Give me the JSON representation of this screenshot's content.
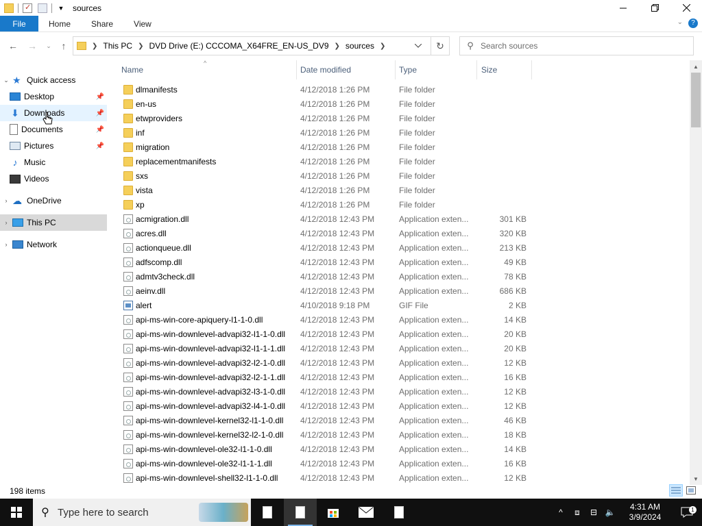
{
  "window": {
    "title": "sources",
    "ribbon_tabs": [
      "File",
      "Home",
      "Share",
      "View"
    ]
  },
  "address": {
    "crumbs": [
      "This PC",
      "DVD Drive (E:) CCCOMA_X64FRE_EN-US_DV9",
      "sources"
    ],
    "search_placeholder": "Search sources"
  },
  "nav": {
    "quick_access": "Quick access",
    "desktop": "Desktop",
    "downloads": "Downloads",
    "documents": "Documents",
    "pictures": "Pictures",
    "music": "Music",
    "videos": "Videos",
    "onedrive": "OneDrive",
    "this_pc": "This PC",
    "network": "Network"
  },
  "columns": {
    "name": "Name",
    "date": "Date modified",
    "type": "Type",
    "size": "Size"
  },
  "files": [
    {
      "name": "dlmanifests",
      "date": "4/12/2018 1:26 PM",
      "type": "File folder",
      "size": "",
      "kind": "folder"
    },
    {
      "name": "en-us",
      "date": "4/12/2018 1:26 PM",
      "type": "File folder",
      "size": "",
      "kind": "folder"
    },
    {
      "name": "etwproviders",
      "date": "4/12/2018 1:26 PM",
      "type": "File folder",
      "size": "",
      "kind": "folder"
    },
    {
      "name": "inf",
      "date": "4/12/2018 1:26 PM",
      "type": "File folder",
      "size": "",
      "kind": "folder"
    },
    {
      "name": "migration",
      "date": "4/12/2018 1:26 PM",
      "type": "File folder",
      "size": "",
      "kind": "folder"
    },
    {
      "name": "replacementmanifests",
      "date": "4/12/2018 1:26 PM",
      "type": "File folder",
      "size": "",
      "kind": "folder"
    },
    {
      "name": "sxs",
      "date": "4/12/2018 1:26 PM",
      "type": "File folder",
      "size": "",
      "kind": "folder"
    },
    {
      "name": "vista",
      "date": "4/12/2018 1:26 PM",
      "type": "File folder",
      "size": "",
      "kind": "folder"
    },
    {
      "name": "xp",
      "date": "4/12/2018 1:26 PM",
      "type": "File folder",
      "size": "",
      "kind": "folder"
    },
    {
      "name": "acmigration.dll",
      "date": "4/12/2018 12:43 PM",
      "type": "Application exten...",
      "size": "301 KB",
      "kind": "file"
    },
    {
      "name": "acres.dll",
      "date": "4/12/2018 12:43 PM",
      "type": "Application exten...",
      "size": "320 KB",
      "kind": "file"
    },
    {
      "name": "actionqueue.dll",
      "date": "4/12/2018 12:43 PM",
      "type": "Application exten...",
      "size": "213 KB",
      "kind": "file"
    },
    {
      "name": "adfscomp.dll",
      "date": "4/12/2018 12:43 PM",
      "type": "Application exten...",
      "size": "49 KB",
      "kind": "file"
    },
    {
      "name": "admtv3check.dll",
      "date": "4/12/2018 12:43 PM",
      "type": "Application exten...",
      "size": "78 KB",
      "kind": "file"
    },
    {
      "name": "aeinv.dll",
      "date": "4/12/2018 12:43 PM",
      "type": "Application exten...",
      "size": "686 KB",
      "kind": "file"
    },
    {
      "name": "alert",
      "date": "4/10/2018 9:18 PM",
      "type": "GIF File",
      "size": "2 KB",
      "kind": "gif"
    },
    {
      "name": "api-ms-win-core-apiquery-l1-1-0.dll",
      "date": "4/12/2018 12:43 PM",
      "type": "Application exten...",
      "size": "14 KB",
      "kind": "file"
    },
    {
      "name": "api-ms-win-downlevel-advapi32-l1-1-0.dll",
      "date": "4/12/2018 12:43 PM",
      "type": "Application exten...",
      "size": "20 KB",
      "kind": "file"
    },
    {
      "name": "api-ms-win-downlevel-advapi32-l1-1-1.dll",
      "date": "4/12/2018 12:43 PM",
      "type": "Application exten...",
      "size": "20 KB",
      "kind": "file"
    },
    {
      "name": "api-ms-win-downlevel-advapi32-l2-1-0.dll",
      "date": "4/12/2018 12:43 PM",
      "type": "Application exten...",
      "size": "12 KB",
      "kind": "file"
    },
    {
      "name": "api-ms-win-downlevel-advapi32-l2-1-1.dll",
      "date": "4/12/2018 12:43 PM",
      "type": "Application exten...",
      "size": "16 KB",
      "kind": "file"
    },
    {
      "name": "api-ms-win-downlevel-advapi32-l3-1-0.dll",
      "date": "4/12/2018 12:43 PM",
      "type": "Application exten...",
      "size": "12 KB",
      "kind": "file"
    },
    {
      "name": "api-ms-win-downlevel-advapi32-l4-1-0.dll",
      "date": "4/12/2018 12:43 PM",
      "type": "Application exten...",
      "size": "12 KB",
      "kind": "file"
    },
    {
      "name": "api-ms-win-downlevel-kernel32-l1-1-0.dll",
      "date": "4/12/2018 12:43 PM",
      "type": "Application exten...",
      "size": "46 KB",
      "kind": "file"
    },
    {
      "name": "api-ms-win-downlevel-kernel32-l2-1-0.dll",
      "date": "4/12/2018 12:43 PM",
      "type": "Application exten...",
      "size": "18 KB",
      "kind": "file"
    },
    {
      "name": "api-ms-win-downlevel-ole32-l1-1-0.dll",
      "date": "4/12/2018 12:43 PM",
      "type": "Application exten...",
      "size": "14 KB",
      "kind": "file"
    },
    {
      "name": "api-ms-win-downlevel-ole32-l1-1-1.dll",
      "date": "4/12/2018 12:43 PM",
      "type": "Application exten...",
      "size": "16 KB",
      "kind": "file"
    },
    {
      "name": "api-ms-win-downlevel-shell32-l1-1-0.dll",
      "date": "4/12/2018 12:43 PM",
      "type": "Application exten...",
      "size": "12 KB",
      "kind": "file"
    }
  ],
  "status": {
    "item_count": "198 items"
  },
  "taskbar": {
    "search_placeholder": "Type here to search",
    "time": "4:31 AM",
    "date": "3/9/2024",
    "notification_count": "1"
  },
  "colors": {
    "file_tab": "#1979ca",
    "selected_nav": "#d9d9d9",
    "taskbar": "#101010",
    "folder": "#f5cf5a"
  }
}
